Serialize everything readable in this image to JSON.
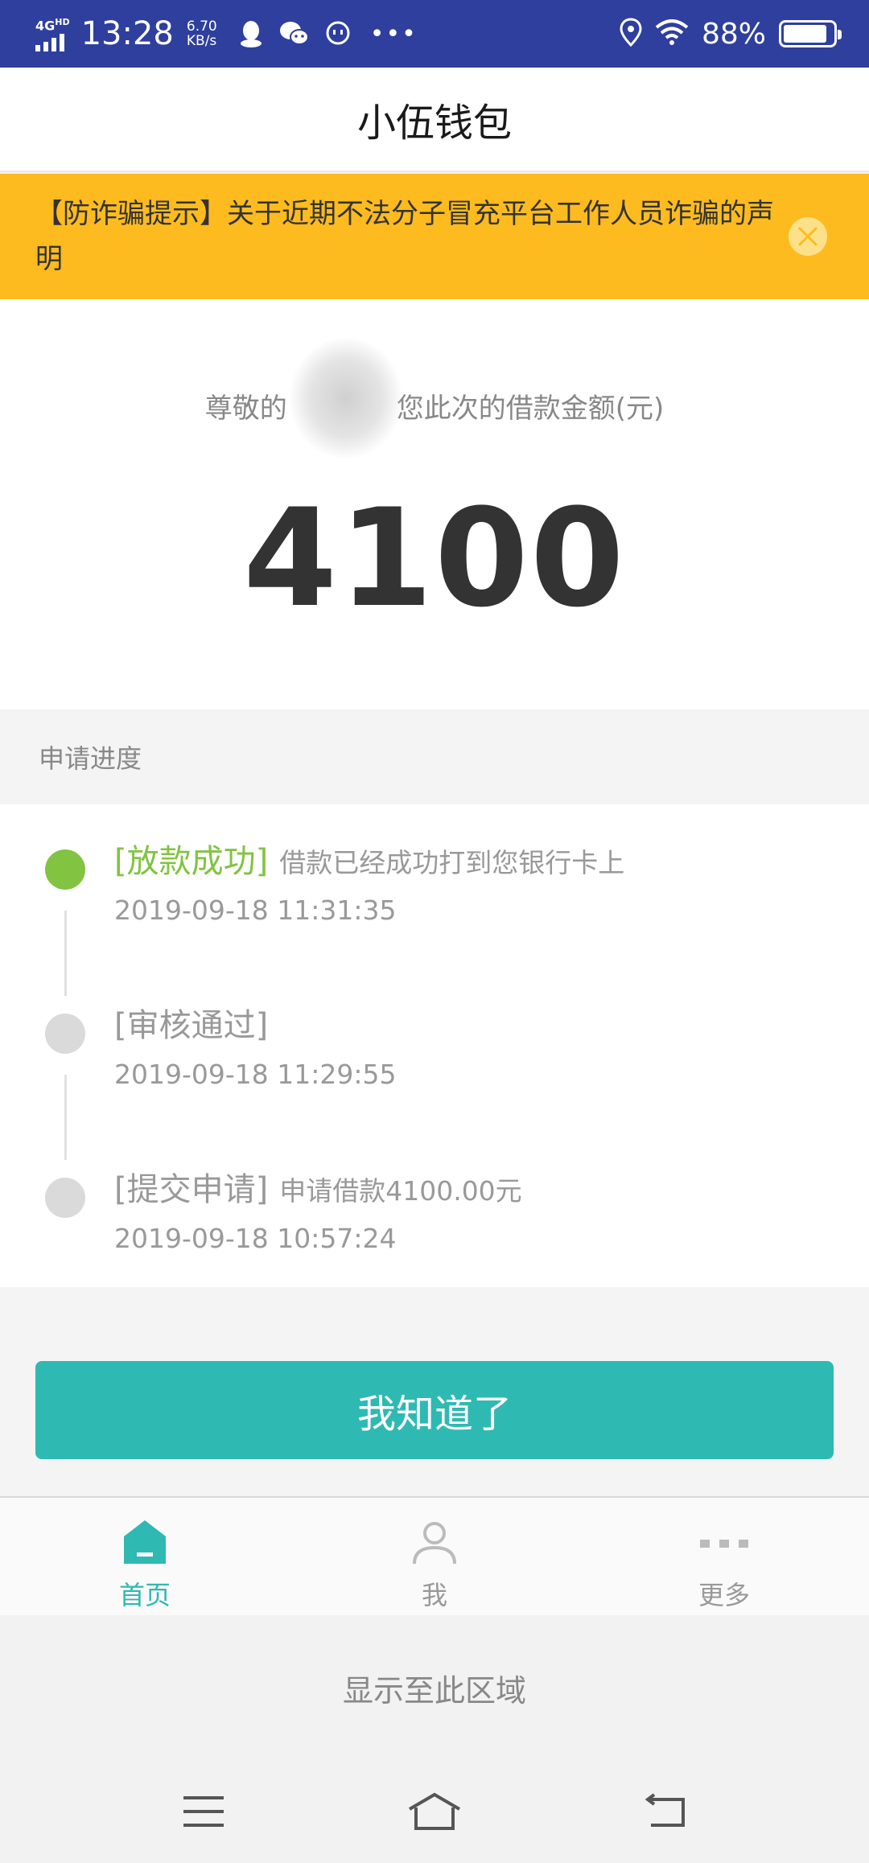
{
  "status_bar": {
    "network": "4G",
    "network_sup": "HD",
    "time": "13:28",
    "speed_value": "6.70",
    "speed_unit": "KB/s",
    "battery": "88%",
    "battery_level": 0.88,
    "icons": [
      "qq-icon",
      "wechat-icon",
      "chat-bubble-icon",
      "more-dots-icon",
      "location-icon",
      "wifi-icon",
      "battery-icon"
    ]
  },
  "header": {
    "title": "小伍钱包"
  },
  "notice": {
    "text": "【防诈骗提示】关于近期不法分子冒充平台工作人员诈骗的声明",
    "color": "#fdbb1f"
  },
  "amount_card": {
    "greeting": "尊敬的　　　　您此次的借款金额(元)",
    "amount": "4100"
  },
  "progress": {
    "section_title": "申请进度",
    "steps": [
      {
        "status": "[放款成功]",
        "desc": "借款已经成功打到您银行卡上",
        "time": "2019-09-18 11:31:35",
        "active": true
      },
      {
        "status": "[审核通过]",
        "desc": "",
        "time": "2019-09-18 11:29:55",
        "active": false
      },
      {
        "status": "[提交申请]",
        "desc": "申请借款4100.00元",
        "time": "2019-09-18 10:57:24",
        "active": false
      }
    ],
    "success_color": "#82c341"
  },
  "confirm_button": {
    "label": "我知道了",
    "color": "#2fb9b3"
  },
  "tab_bar": {
    "tabs": [
      {
        "label": "首页",
        "icon": "home-icon",
        "active": true
      },
      {
        "label": "我",
        "icon": "user-icon",
        "active": false
      },
      {
        "label": "更多",
        "icon": "more-icon",
        "active": false
      }
    ]
  },
  "display_area": {
    "text": "显示至此区域"
  },
  "system_nav": {
    "buttons": [
      "menu-icon",
      "home-nav-icon",
      "back-icon"
    ]
  }
}
